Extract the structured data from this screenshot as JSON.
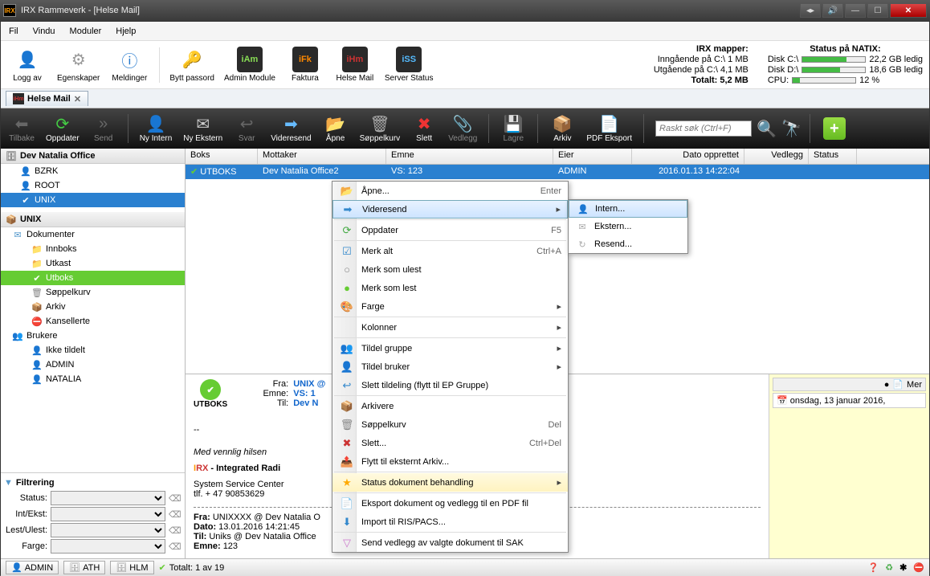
{
  "window": {
    "title": "IRX Rammeverk - [Helse Mail]"
  },
  "menubar": [
    "Fil",
    "Vindu",
    "Moduler",
    "Hjelp"
  ],
  "toolbar": {
    "logoff": "Logg av",
    "props": "Egenskaper",
    "messages": "Meldinger",
    "changepw": "Bytt passord",
    "admin": "Admin Module",
    "faktura": "Faktura",
    "helse": "Helse Mail",
    "server": "Server Status"
  },
  "modlabels": {
    "iAm": "iAm",
    "iFk": "iFk",
    "iHm": "iHm",
    "iSS": "iSS"
  },
  "status_info": {
    "header1": "IRX mapper:",
    "in": "Inngående på C:\\ 1 MB",
    "out": "Utgående på C:\\ 4,1 MB",
    "total": "Totalt: 5,2 MB",
    "header2": "Status på NATIX:",
    "diskC": "Disk C:\\",
    "diskC_free": "22,2 GB ledig",
    "diskD": "Disk D:\\",
    "diskD_free": "18,6 GB ledig",
    "cpu": "CPU:",
    "cpu_pct": "12 %"
  },
  "tab": {
    "label": "Helse Mail"
  },
  "blackbar": {
    "back": "Tilbake",
    "refresh": "Oppdater",
    "send": "Send",
    "newint": "Ny Intern",
    "newext": "Ny Ekstern",
    "reply": "Svar",
    "forward": "Videresend",
    "open": "Åpne",
    "trash": "Søppelkurv",
    "delete": "Slett",
    "attach": "Vedlegg",
    "save": "Lagre",
    "archive": "Arkiv",
    "pdf": "PDF Eksport",
    "search_ph": "Raskt søk (Ctrl+F)"
  },
  "tree": {
    "dev_header": "Dev Natalia Office",
    "items1": [
      "BZRK",
      "ROOT",
      "UNIX"
    ],
    "unix_header": "UNIX",
    "docs": "Dokumenter",
    "inbox": "Innboks",
    "drafts": "Utkast",
    "outbox": "Utboks",
    "trash": "Søppelkurv",
    "archive": "Arkiv",
    "cancelled": "Kansellerte",
    "users": "Brukere",
    "unassigned": "Ikke tildelt",
    "user1": "ADMIN",
    "user2": "NATALIA"
  },
  "filter": {
    "header": "Filtrering",
    "status": "Status:",
    "intext": "Int/Ekst:",
    "read": "Lest/Ulest:",
    "color": "Farge:"
  },
  "grid": {
    "cols": {
      "boks": "Boks",
      "mottaker": "Mottaker",
      "emne": "Emne",
      "eier": "Eier",
      "dato": "Dato opprettet",
      "vedlegg": "Vedlegg",
      "status": "Status"
    },
    "row": {
      "boks": "UTBOKS",
      "mottaker": "Dev Natalia Office2",
      "emne": "VS: 123",
      "eier": "ADMIN",
      "dato": "2016.01.13   14:22:04"
    }
  },
  "preview": {
    "badge": "UTBOKS",
    "labels": {
      "fra": "Fra:",
      "emne": "Emne:",
      "til": "Til:"
    },
    "fra": "UNIX @",
    "emne": "VS: 1",
    "til": "Dev N",
    "sig": "Med vennlig hilsen",
    "brand_rest": " - Integrated Radi",
    "svc": "System Service Center",
    "tlf": "tlf. + 47 90853629",
    "divider": "--",
    "fra2_label": "Fra:",
    "fra2": "UNIXXXX @ Dev Natalia O",
    "dato2_label": "Dato:",
    "dato2": "13.01.2016 14:21:45",
    "til2_label": "Til:",
    "til2": "Uniks @ Dev Natalia Office",
    "emne2_label": "Emne:",
    "emne2": "123",
    "mer": "Mer",
    "date_full": "onsdag, 13 januar 2016,"
  },
  "context": {
    "open": "Åpne...",
    "open_sc": "Enter",
    "forward": "Videresend",
    "refresh": "Oppdater",
    "refresh_sc": "F5",
    "markall": "Merk alt",
    "markall_sc": "Ctrl+A",
    "markunread": "Merk som ulest",
    "markread": "Merk som lest",
    "color": "Farge",
    "columns": "Kolonner",
    "assign_group": "Tildel gruppe",
    "assign_user": "Tildel bruker",
    "del_assign": "Slett tildeling (flytt til EP Gruppe)",
    "archive": "Arkivere",
    "trash": "Søppelkurv",
    "trash_sc": "Del",
    "delete": "Slett...",
    "delete_sc": "Ctrl+Del",
    "move_ext": "Flytt til eksternt Arkiv...",
    "status_doc": "Status dokument behandling",
    "export_pdf": "Eksport dokument og vedlegg til en PDF fil",
    "import_ris": "Import til RIS/PACS...",
    "send_sak": "Send vedlegg av valgte dokument til SAK"
  },
  "submenu": {
    "intern": "Intern...",
    "ekstern": "Ekstern...",
    "resend": "Resend..."
  },
  "statusbar": {
    "admin": "ADMIN",
    "ath": "ATH",
    "hlm": "HLM",
    "count": "Totalt: 1 av 19"
  }
}
